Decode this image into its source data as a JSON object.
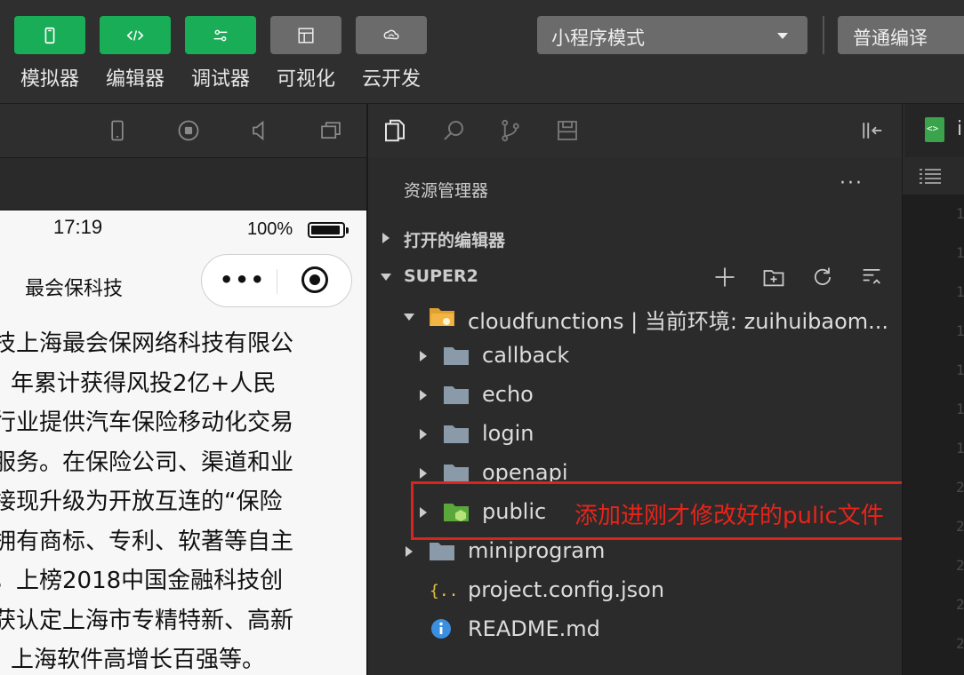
{
  "toolbar": {
    "buttons": [
      {
        "label": "模拟器",
        "icon": "phone-icon",
        "color": "#1aad57"
      },
      {
        "label": "编辑器",
        "icon": "code-icon",
        "color": "#1aad57"
      },
      {
        "label": "调试器",
        "icon": "sliders-icon",
        "color": "#1aad57"
      },
      {
        "label": "可视化",
        "icon": "layout-icon",
        "color": "#6b6b6b"
      },
      {
        "label": "云开发",
        "icon": "cloud-icon",
        "color": "#6b6b6b"
      }
    ],
    "mode_select": "小程序模式",
    "compile_select": "普通编译"
  },
  "simulator": {
    "status_time": "17:19",
    "battery": "100%",
    "nav_title": "最会保科技",
    "capsule_dots": "•••",
    "article_lines": [
      "技上海最会保网络科技有限公",
      "年累计获得风投2亿+人民",
      "行业提供汽车保险移动化交易",
      "服务。在保险公司、渠道和业",
      "接现升级为开放互连的“保险",
      "拥有商标、专利、软著等自主",
      "，上榜2018中国金融科技创",
      "获认定上海市专精特新、高新",
      "上海软件高增长百强等。"
    ]
  },
  "explorer": {
    "title": "资源管理器",
    "more": "···",
    "open_editors": "打开的编辑器",
    "project": "SUPER2",
    "tree": [
      {
        "name": "cloudfunctions | 当前环境: zuihuibaom...",
        "icon": "cloud-folder-icon",
        "expanded": true,
        "depth": 1
      },
      {
        "name": "callback",
        "icon": "folder-icon",
        "depth": 2
      },
      {
        "name": "echo",
        "icon": "folder-icon",
        "depth": 2
      },
      {
        "name": "login",
        "icon": "folder-icon",
        "depth": 2
      },
      {
        "name": "openapi",
        "icon": "folder-icon",
        "depth": 2
      },
      {
        "name": "public",
        "icon": "cloud-function-folder-icon",
        "depth": 2
      },
      {
        "name": "miniprogram",
        "icon": "folder-icon",
        "depth": 1
      },
      {
        "name": "project.config.json",
        "icon": "json-icon",
        "depth": 1
      },
      {
        "name": "README.md",
        "icon": "info-icon",
        "depth": 1
      }
    ]
  },
  "annotation": "添加进刚才修改好的pulic文件",
  "editor": {
    "tab_name": "i",
    "line_numbers": [
      "1",
      "1",
      "1",
      "1",
      "1",
      "1",
      "1",
      "2",
      "2",
      "2",
      "2",
      "2"
    ]
  },
  "colors": {
    "accent_green": "#1aad57",
    "annotation_red": "#d9261c",
    "folder_gray": "#8a9aa8"
  }
}
